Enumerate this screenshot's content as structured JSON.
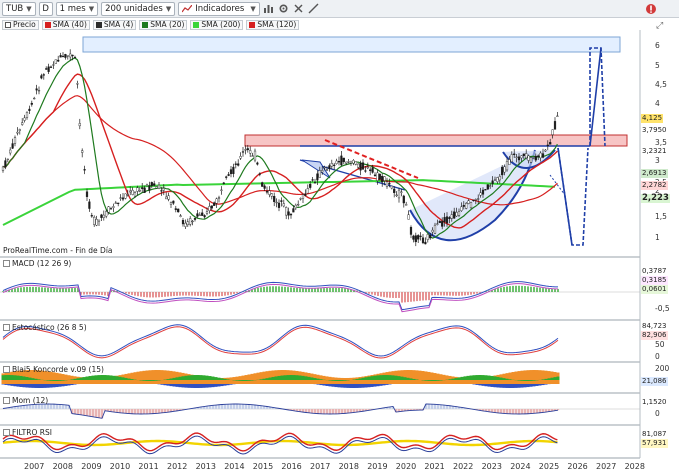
{
  "toolbar": {
    "symbol": "TUB",
    "d_label": "D",
    "period": "1 mes",
    "units": "200 unidades",
    "indicators_label": "Indicadores"
  },
  "legend": [
    {
      "label": "Precio",
      "color": "#ffffff"
    },
    {
      "label": "SMA (40)",
      "color": "#d62020"
    },
    {
      "label": "SMA (4)",
      "color": "#2c2c2c"
    },
    {
      "label": "SMA (20)",
      "color": "#1e7a1e"
    },
    {
      "label": "SMA (200)",
      "color": "#3ad43a"
    },
    {
      "label": "SMA (120)",
      "color": "#d62020"
    }
  ],
  "source_label": "ProRealTime.com - Fin de Día",
  "panels": {
    "macd": "MACD (12 26 9)",
    "stoch": "Estocástico (26 8 5)",
    "blai": "Blai5 Koncorde v.09 (15)",
    "mom": "Mom (12)",
    "filtro": "FILTRO RSI"
  },
  "price_axis": [
    "6",
    "5",
    "4,5",
    "4",
    "3,5",
    "3",
    "2,5",
    "2",
    "1,5",
    "1"
  ],
  "price_tags": [
    {
      "text": "4,125",
      "bg": "#ffe36b"
    },
    {
      "text": "3,7950",
      "bg": "#ffffff"
    },
    {
      "text": "3,2321",
      "bg": "#ffffff"
    },
    {
      "text": "2,6913",
      "bg": "#cfeacc"
    },
    {
      "text": "2,2782",
      "bg": "#ffd6d6"
    },
    {
      "text": "2,223",
      "bg": "#d9f5d2"
    }
  ],
  "indicator_tags": {
    "macd": [
      "0,3787",
      "0,3185",
      "0,0601"
    ],
    "macd_axis": [
      "-0,5"
    ],
    "stoch": [
      "84,723",
      "82,906"
    ],
    "stoch_axis": [
      "50",
      "0"
    ],
    "blai": [
      "200",
      "21,086"
    ],
    "mom": [
      "1,1520",
      "0"
    ],
    "filtro": [
      "81,087",
      "57,931"
    ]
  },
  "years": [
    "2007",
    "2008",
    "2009",
    "2010",
    "2011",
    "2012",
    "2013",
    "2014",
    "2015",
    "2016",
    "2017",
    "2018",
    "2019",
    "2020",
    "2021",
    "2022",
    "2023",
    "2024",
    "2025",
    "2026",
    "2027",
    "2028"
  ]
}
